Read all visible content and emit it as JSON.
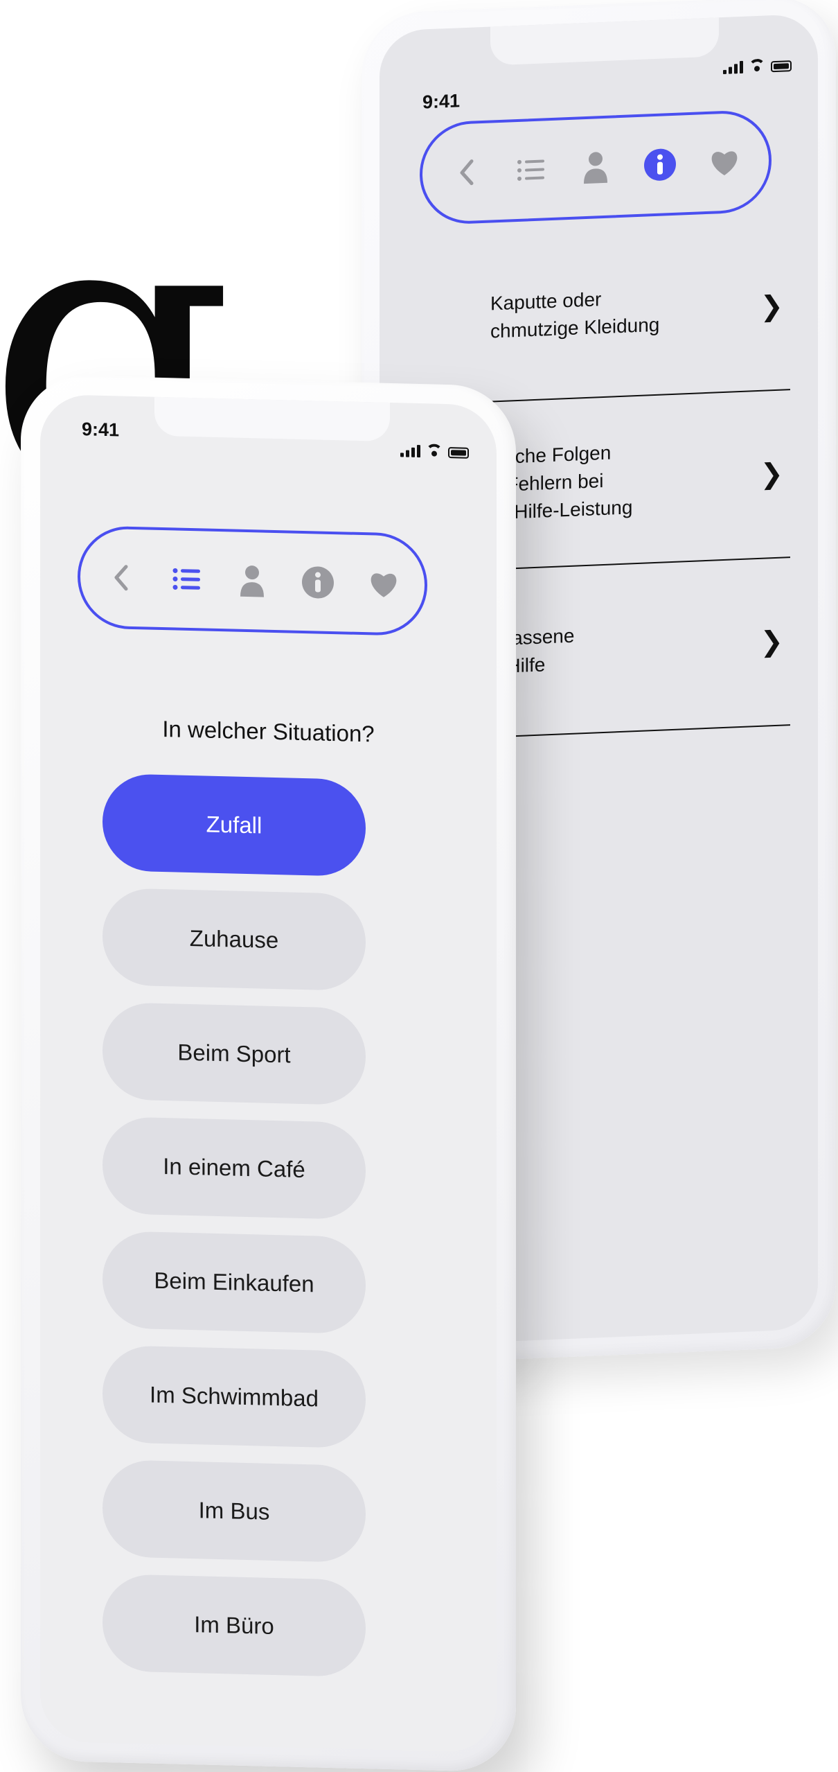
{
  "colors": {
    "accent": "#4b51ef",
    "nav_inactive": "#9a9a9f",
    "button_bg": "#dfdfe4"
  },
  "background_letter": "g",
  "back_phone": {
    "status_time": "9:41",
    "nav_icons": [
      "chevron-left-icon",
      "list-icon",
      "person-icon",
      "info-icon",
      "heart-icon"
    ],
    "active_nav": "info-icon",
    "topics": [
      {
        "text": "Kaputte oder\nchmutzige Kleidung"
      },
      {
        "text": "ntliche Folgen\nn Fehlern bei\ner-Hilfe-Leistung"
      },
      {
        "text": "erlassene\ne Hilfe"
      }
    ]
  },
  "front_phone": {
    "status_time": "9:41",
    "nav_icons": [
      "chevron-left-icon",
      "list-icon",
      "person-icon",
      "info-icon",
      "heart-icon"
    ],
    "active_nav": "list-icon",
    "question": "In welcher Situation?",
    "choices": [
      {
        "label": "Zufall",
        "active": true
      },
      {
        "label": "Zuhause",
        "active": false
      },
      {
        "label": "Beim Sport",
        "active": false
      },
      {
        "label": "In einem Café",
        "active": false
      },
      {
        "label": "Beim Einkaufen",
        "active": false
      },
      {
        "label": "Im Schwimmbad",
        "active": false
      },
      {
        "label": "Im Bus",
        "active": false
      },
      {
        "label": "Im Büro",
        "active": false
      }
    ]
  }
}
